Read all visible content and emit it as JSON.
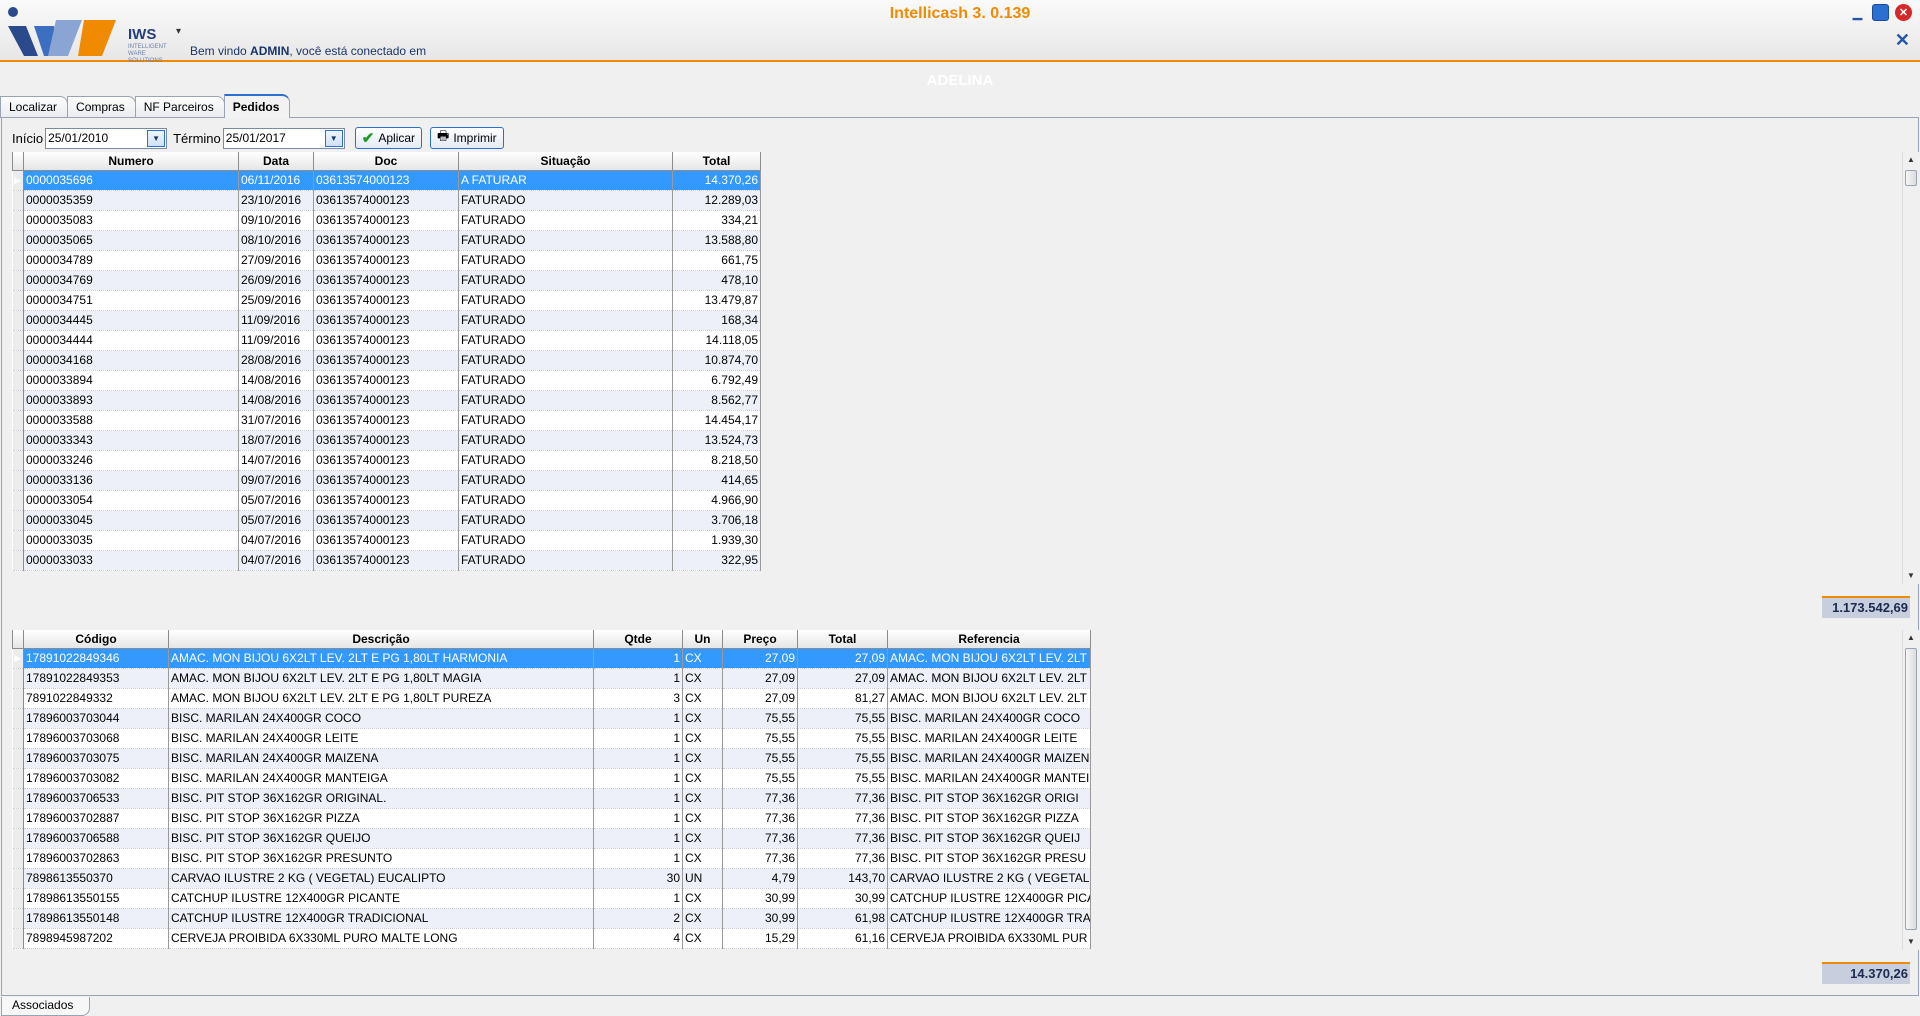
{
  "window": {
    "title": "Intellicash 3. 0.139",
    "subtitle": "ADELINA",
    "minimize_icon": "minimize-icon",
    "maximize_icon": "maximize-icon",
    "close_icon": "close-icon"
  },
  "header": {
    "logo_text": "IWS",
    "logo_sub": "INTELLIGENT WARE SOLUTIONS",
    "welcome_prefix": "Bem vindo ",
    "welcome_user": "ADMIN",
    "welcome_suffix": ", você está conectado em"
  },
  "tabs": [
    {
      "label": "Localizar",
      "active": false
    },
    {
      "label": "Compras",
      "active": false
    },
    {
      "label": "NF Parceiros",
      "active": false
    },
    {
      "label": "Pedidos",
      "active": true
    }
  ],
  "filter": {
    "start_label": "Início",
    "start_value": "25/01/2010",
    "end_label": "Término",
    "end_value": "25/01/2017",
    "apply_label": "Aplicar",
    "print_label": "Imprimir"
  },
  "orders": {
    "columns": [
      "Numero",
      "Data",
      "Doc",
      "Situação",
      "Total"
    ],
    "rows": [
      [
        "0000035696",
        "06/11/2016",
        "03613574000123",
        "A FATURAR",
        "14.370,26"
      ],
      [
        "0000035359",
        "23/10/2016",
        "03613574000123",
        "FATURADO",
        "12.289,03"
      ],
      [
        "0000035083",
        "09/10/2016",
        "03613574000123",
        "FATURADO",
        "334,21"
      ],
      [
        "0000035065",
        "08/10/2016",
        "03613574000123",
        "FATURADO",
        "13.588,80"
      ],
      [
        "0000034789",
        "27/09/2016",
        "03613574000123",
        "FATURADO",
        "661,75"
      ],
      [
        "0000034769",
        "26/09/2016",
        "03613574000123",
        "FATURADO",
        "478,10"
      ],
      [
        "0000034751",
        "25/09/2016",
        "03613574000123",
        "FATURADO",
        "13.479,87"
      ],
      [
        "0000034445",
        "11/09/2016",
        "03613574000123",
        "FATURADO",
        "168,34"
      ],
      [
        "0000034444",
        "11/09/2016",
        "03613574000123",
        "FATURADO",
        "14.118,05"
      ],
      [
        "0000034168",
        "28/08/2016",
        "03613574000123",
        "FATURADO",
        "10.874,70"
      ],
      [
        "0000033894",
        "14/08/2016",
        "03613574000123",
        "FATURADO",
        "6.792,49"
      ],
      [
        "0000033893",
        "14/08/2016",
        "03613574000123",
        "FATURADO",
        "8.562,77"
      ],
      [
        "0000033588",
        "31/07/2016",
        "03613574000123",
        "FATURADO",
        "14.454,17"
      ],
      [
        "0000033343",
        "18/07/2016",
        "03613574000123",
        "FATURADO",
        "13.524,73"
      ],
      [
        "0000033246",
        "14/07/2016",
        "03613574000123",
        "FATURADO",
        "8.218,50"
      ],
      [
        "0000033136",
        "09/07/2016",
        "03613574000123",
        "FATURADO",
        "414,65"
      ],
      [
        "0000033054",
        "05/07/2016",
        "03613574000123",
        "FATURADO",
        "4.966,90"
      ],
      [
        "0000033045",
        "05/07/2016",
        "03613574000123",
        "FATURADO",
        "3.706,18"
      ],
      [
        "0000033035",
        "04/07/2016",
        "03613574000123",
        "FATURADO",
        "1.939,30"
      ],
      [
        "0000033033",
        "04/07/2016",
        "03613574000123",
        "FATURADO",
        "322,95"
      ]
    ],
    "total": "1.173.542,69"
  },
  "items": {
    "columns": [
      "Código",
      "Descrição",
      "Qtde",
      "Un",
      "Preço",
      "Total",
      "Referencia"
    ],
    "rows": [
      [
        "17891022849346",
        "AMAC. MON BIJOU 6X2LT LEV. 2LT E PG 1,80LT HARMONIA",
        "1",
        "CX",
        "27,09",
        "27,09",
        "AMAC. MON BIJOU 6X2LT LEV. 2LT"
      ],
      [
        "17891022849353",
        "AMAC. MON BIJOU 6X2LT LEV. 2LT E PG 1,80LT MAGIA",
        "1",
        "CX",
        "27,09",
        "27,09",
        "AMAC. MON BIJOU 6X2LT LEV. 2LT"
      ],
      [
        "7891022849332",
        "AMAC. MON BIJOU 6X2LT LEV. 2LT E PG 1,80LT PUREZA",
        "3",
        "CX",
        "27,09",
        "81,27",
        "AMAC. MON BIJOU 6X2LT LEV. 2LT"
      ],
      [
        "17896003703044",
        "BISC. MARILAN 24X400GR COCO",
        "1",
        "CX",
        "75,55",
        "75,55",
        "BISC. MARILAN 24X400GR COCO"
      ],
      [
        "17896003703068",
        "BISC. MARILAN 24X400GR LEITE",
        "1",
        "CX",
        "75,55",
        "75,55",
        "BISC. MARILAN 24X400GR LEITE"
      ],
      [
        "17896003703075",
        "BISC. MARILAN 24X400GR MAIZENA",
        "1",
        "CX",
        "75,55",
        "75,55",
        "BISC. MARILAN 24X400GR MAIZEN"
      ],
      [
        "17896003703082",
        "BISC. MARILAN 24X400GR MANTEIGA",
        "1",
        "CX",
        "75,55",
        "75,55",
        "BISC. MARILAN 24X400GR MANTEI"
      ],
      [
        "17896003706533",
        "BISC. PIT STOP 36X162GR  ORIGINAL.",
        "1",
        "CX",
        "77,36",
        "77,36",
        "BISC. PIT STOP 36X162GR  ORIGI"
      ],
      [
        "17896003702887",
        "BISC. PIT STOP 36X162GR  PIZZA",
        "1",
        "CX",
        "77,36",
        "77,36",
        "BISC. PIT STOP 36X162GR  PIZZA"
      ],
      [
        "17896003706588",
        "BISC. PIT STOP 36X162GR  QUEIJO",
        "1",
        "CX",
        "77,36",
        "77,36",
        "BISC. PIT STOP 36X162GR  QUEIJ"
      ],
      [
        "17896003702863",
        "BISC. PIT STOP 36X162GR PRESUNTO",
        "1",
        "CX",
        "77,36",
        "77,36",
        "BISC. PIT STOP 36X162GR PRESU"
      ],
      [
        "7898613550370",
        "CARVAO ILUSTRE 2 KG ( VEGETAL) EUCALIPTO",
        "30",
        "UN",
        "4,79",
        "143,70",
        "CARVAO ILUSTRE 2 KG ( VEGETAL"
      ],
      [
        "17898613550155",
        "CATCHUP ILUSTRE 12X400GR PICANTE",
        "1",
        "CX",
        "30,99",
        "30,99",
        "CATCHUP ILUSTRE 12X400GR PICA"
      ],
      [
        "17898613550148",
        "CATCHUP ILUSTRE 12X400GR TRADICIONAL",
        "2",
        "CX",
        "30,99",
        "61,98",
        "CATCHUP ILUSTRE 12X400GR TRA"
      ],
      [
        "7898945987202",
        "CERVEJA PROIBIDA 6X330ML PURO MALTE LONG",
        "4",
        "CX",
        "15,29",
        "61,16",
        "CERVEJA PROIBIDA 6X330ML PUR"
      ]
    ],
    "total": "14.370,26"
  },
  "bottom_tab": "Associados",
  "colors": {
    "accent_orange": "#f08a00",
    "selection_blue": "#3399ff",
    "alt_row": "#eef0f9"
  }
}
